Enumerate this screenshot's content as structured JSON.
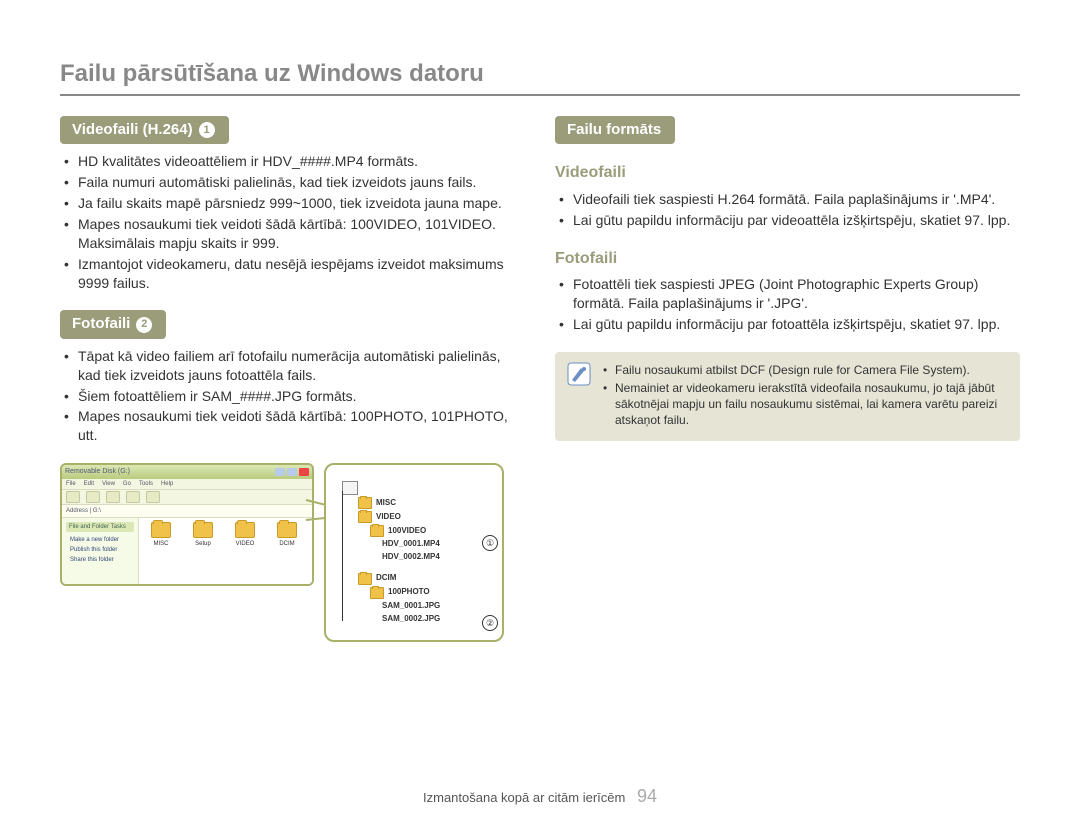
{
  "title": "Failu pārsūtīšana uz Windows datoru",
  "left": {
    "section1": {
      "label": "Videofaili (H.264)",
      "badge": "1",
      "items": [
        "HD kvalitātes videoattēliem ir HDV_####.MP4 formāts.",
        "Faila numuri automātiski palielinās, kad tiek izveidots jauns fails.",
        "Ja failu skaits mapē pārsniedz 999~1000, tiek izveidota jauna mape.",
        "Mapes nosaukumi tiek veidoti šādā kārtībā: 100VIDEO, 101VIDEO. Maksimālais mapju skaits ir 999.",
        "Izmantojot videokameru, datu nesējā iespējams izveidot maksimums 9999 failus."
      ]
    },
    "section2": {
      "label": "Fotofaili",
      "badge": "2",
      "items": [
        "Tāpat kā video failiem arī fotofailu numerācija automātiski palielinās, kad tiek izveidots jauns fotoattēla fails.",
        "Šiem fotoattēliem ir SAM_####.JPG formāts.",
        "Mapes nosaukumi tiek veidoti šādā kārtībā: 100PHOTO, 101PHOTO, utt."
      ]
    }
  },
  "right": {
    "section1": {
      "label": "Failu formāts"
    },
    "sub1": {
      "heading": "Videofaili",
      "items": [
        "Videofaili tiek saspiesti H.264 formātā. Faila paplašinājums ir '.MP4'.",
        "Lai gūtu papildu informāciju par videoattēla izšķirtspēju, skatiet 97. lpp."
      ]
    },
    "sub2": {
      "heading": "Fotofaili",
      "items": [
        "Fotoattēli tiek saspiesti JPEG (Joint Photographic Experts Group) formātā. Faila paplašinājums ir '.JPG'.",
        "Lai gūtu papildu informāciju par fotoattēla izšķirtspēju, skatiet 97. lpp."
      ]
    },
    "note": {
      "items": [
        "Failu nosaukumi atbilst DCF (Design rule for Camera File System).",
        "Nemainiet ar videokameru ierakstītā videofaila nosaukumu, jo tajā jābūt sākotnējai mapju un failu nosaukumu sistēmai, lai kamera varētu pareizi atskaņot failu."
      ]
    }
  },
  "filemanager": {
    "menu": [
      "File",
      "Edit",
      "View",
      "Go",
      "Tools",
      "Help"
    ],
    "sidebar_header": "File and Folder Tasks",
    "sidebar_items": [
      "Make a new folder",
      "Publish this folder",
      "Share this folder"
    ],
    "folders": [
      "MISC",
      "Setup",
      "VIDEO",
      "DCIM"
    ]
  },
  "tree": {
    "misc": "MISC",
    "video": "VIDEO",
    "v100": "100VIDEO",
    "f1": "HDV_0001.MP4",
    "f2": "HDV_0002.MP4",
    "dcim": "DCIM",
    "p100": "100PHOTO",
    "s1": "SAM_0001.JPG",
    "s2": "SAM_0002.JPG",
    "c1": "①",
    "c2": "②"
  },
  "footer": {
    "text": "Izmantošana kopā ar citām ierīcēm",
    "page": "94"
  }
}
